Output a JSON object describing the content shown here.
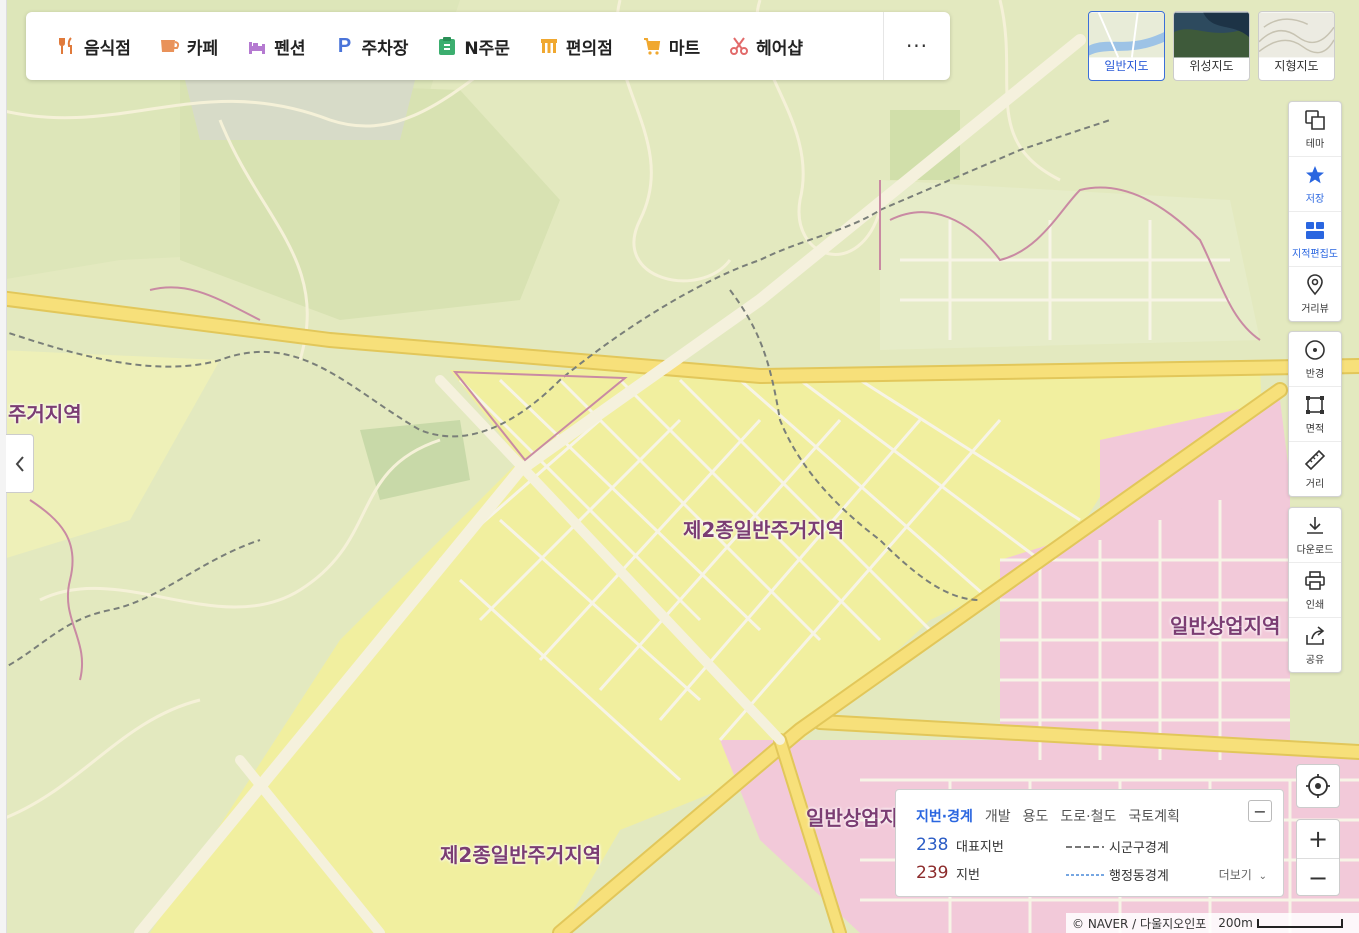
{
  "categories": [
    {
      "label": "음식점",
      "icon": "restaurant-icon",
      "color": "#e07a3b"
    },
    {
      "label": "카페",
      "icon": "cafe-icon",
      "color": "#e9925a"
    },
    {
      "label": "펜션",
      "icon": "pension-icon",
      "color": "#b57ad1"
    },
    {
      "label": "주차장",
      "icon": "parking-icon",
      "color": "#4a74d9"
    },
    {
      "label": "N주문",
      "icon": "n-order-icon",
      "color": "#3cae6f"
    },
    {
      "label": "편의점",
      "icon": "convenience-store-icon",
      "color": "#f0a830"
    },
    {
      "label": "마트",
      "icon": "mart-icon",
      "color": "#f0a830"
    },
    {
      "label": "헤어샵",
      "icon": "hair-shop-icon",
      "color": "#e26a6a"
    }
  ],
  "category_more": "···",
  "map_types": [
    {
      "label": "일반지도",
      "active": true
    },
    {
      "label": "위성지도",
      "active": false
    },
    {
      "label": "지형지도",
      "active": false
    }
  ],
  "tools_group1": [
    {
      "label": "테마",
      "icon": "theme-icon"
    },
    {
      "label": "저장",
      "icon": "star-icon"
    },
    {
      "label": "지적편집도",
      "icon": "cadastral-icon"
    },
    {
      "label": "거리뷰",
      "icon": "street-view-icon"
    }
  ],
  "tools_group2": [
    {
      "label": "반경",
      "icon": "radius-icon"
    },
    {
      "label": "면적",
      "icon": "area-icon"
    },
    {
      "label": "거리",
      "icon": "ruler-icon"
    }
  ],
  "tools_group3": [
    {
      "label": "다운로드",
      "icon": "download-icon"
    },
    {
      "label": "인쇄",
      "icon": "print-icon"
    },
    {
      "label": "공유",
      "icon": "share-icon"
    }
  ],
  "zoom": {
    "in": "+",
    "out": "−"
  },
  "map_labels": [
    {
      "text": "주거지역"
    },
    {
      "text": "제2종일반주거지역"
    },
    {
      "text": "일반상업지역"
    },
    {
      "text": "일반상업지"
    },
    {
      "text": "제2종일반주거지역"
    }
  ],
  "legend": {
    "tabs": [
      "지번·경계",
      "개발",
      "용도",
      "도로·철도",
      "국토계획"
    ],
    "minimize": "−",
    "rows": [
      {
        "num": "238",
        "label": "대표지번",
        "num_color": "#2b5cc5"
      },
      {
        "num": "239",
        "label": "지번",
        "num_color": "#8c2b2b"
      }
    ],
    "lines": [
      {
        "label": "시군구경계",
        "color": "#777777"
      },
      {
        "label": "행정동경계",
        "color": "#4a8ad9"
      }
    ],
    "more": "더보기"
  },
  "attribution": {
    "text": "© NAVER / 다울지오인포",
    "scale": "200m"
  },
  "colors": {
    "residential": "#f1ef9c",
    "commercial": "#f3c6d6",
    "green": "#dfe8b6",
    "road": "#f7e07a"
  }
}
